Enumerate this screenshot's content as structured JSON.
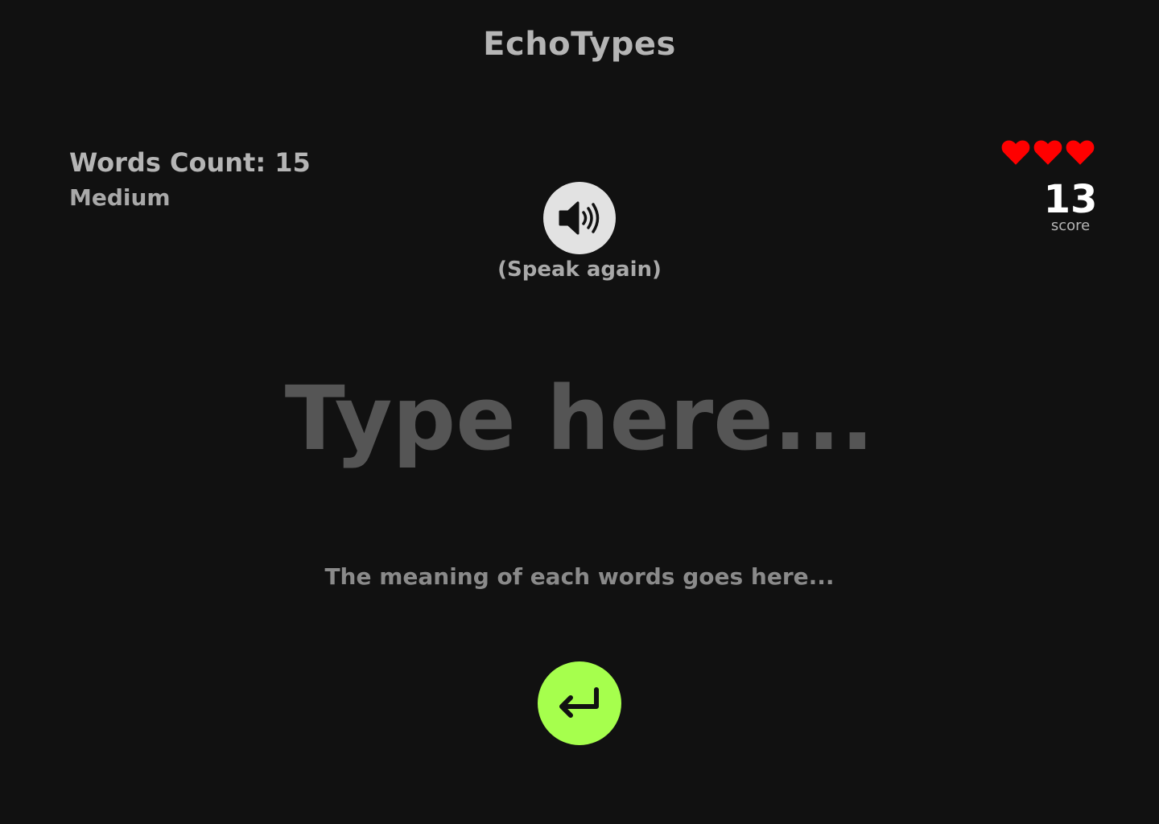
{
  "app": {
    "title": "EchoTypes"
  },
  "stats": {
    "words_count": "Words Count: 15",
    "difficulty": "Medium"
  },
  "lives": {
    "count": 3,
    "icon": "heart-icon",
    "color": "#ff0000"
  },
  "score": {
    "value": "13",
    "label": "score"
  },
  "speak": {
    "icon": "speaker-icon",
    "hint": "(Speak again)"
  },
  "input": {
    "value": "",
    "placeholder": "Type here..."
  },
  "meaning": {
    "text": "The meaning of each words goes here..."
  },
  "submit": {
    "icon": "enter-arrow-icon",
    "color": "#a6ff4d"
  }
}
